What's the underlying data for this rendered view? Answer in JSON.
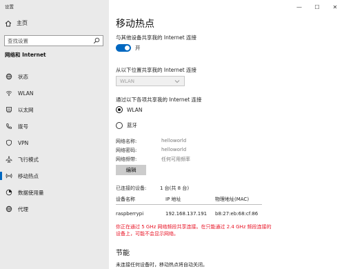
{
  "window": {
    "title": "设置",
    "controls": [
      "—",
      "☐",
      "✕"
    ]
  },
  "sidebar": {
    "home": "主页",
    "search_placeholder": "查找设置",
    "section": "网络和 Internet",
    "items": [
      {
        "label": "状态",
        "icon": "globe-icon"
      },
      {
        "label": "WLAN",
        "icon": "wifi-icon"
      },
      {
        "label": "以太网",
        "icon": "ethernet-icon"
      },
      {
        "label": "拨号",
        "icon": "phone-icon"
      },
      {
        "label": "VPN",
        "icon": "vpn-icon"
      },
      {
        "label": "飞行模式",
        "icon": "airplane-icon"
      },
      {
        "label": "移动热点",
        "icon": "hotspot-icon",
        "active": true
      },
      {
        "label": "数据使用量",
        "icon": "data-usage-icon"
      },
      {
        "label": "代理",
        "icon": "globe-icon"
      }
    ]
  },
  "main": {
    "title": "移动热点",
    "share_label": "与其他设备共享我的 Internet 连接",
    "toggle_state": "开",
    "share_from_label": "从以下位置共享我的 Internet 连接",
    "share_from_value": "WLAN",
    "share_over_label": "通过以下各项共享我的 Internet 连接",
    "options": [
      {
        "label": "WLAN",
        "selected": true
      },
      {
        "label": "蓝牙",
        "selected": false
      }
    ],
    "network": {
      "name_k": "网络名称:",
      "name_v": "helloworld",
      "pass_k": "网络密码:",
      "pass_v": "helloworld",
      "band_k": "网络频带:",
      "band_v": "任何可用频率"
    },
    "edit": "编辑",
    "connected_k": "已连接的设备:",
    "connected_v": "1 台(共 8 台)",
    "table": {
      "headers": [
        "设备名称",
        "IP 地址",
        "物理地址(MAC)"
      ],
      "rows": [
        [
          "raspberrypi",
          "192.168.137.191",
          "b8:27:eb:68:cf:86"
        ]
      ]
    },
    "warning": "你正在通过 5 GHz 网络频段共享连接。在只能通过 2.4 GHz 频段连接的设备上，可能不会显示网络。",
    "power_title": "节能",
    "power_desc": "未连接任何设备时，移动热点将自动关闭。"
  }
}
